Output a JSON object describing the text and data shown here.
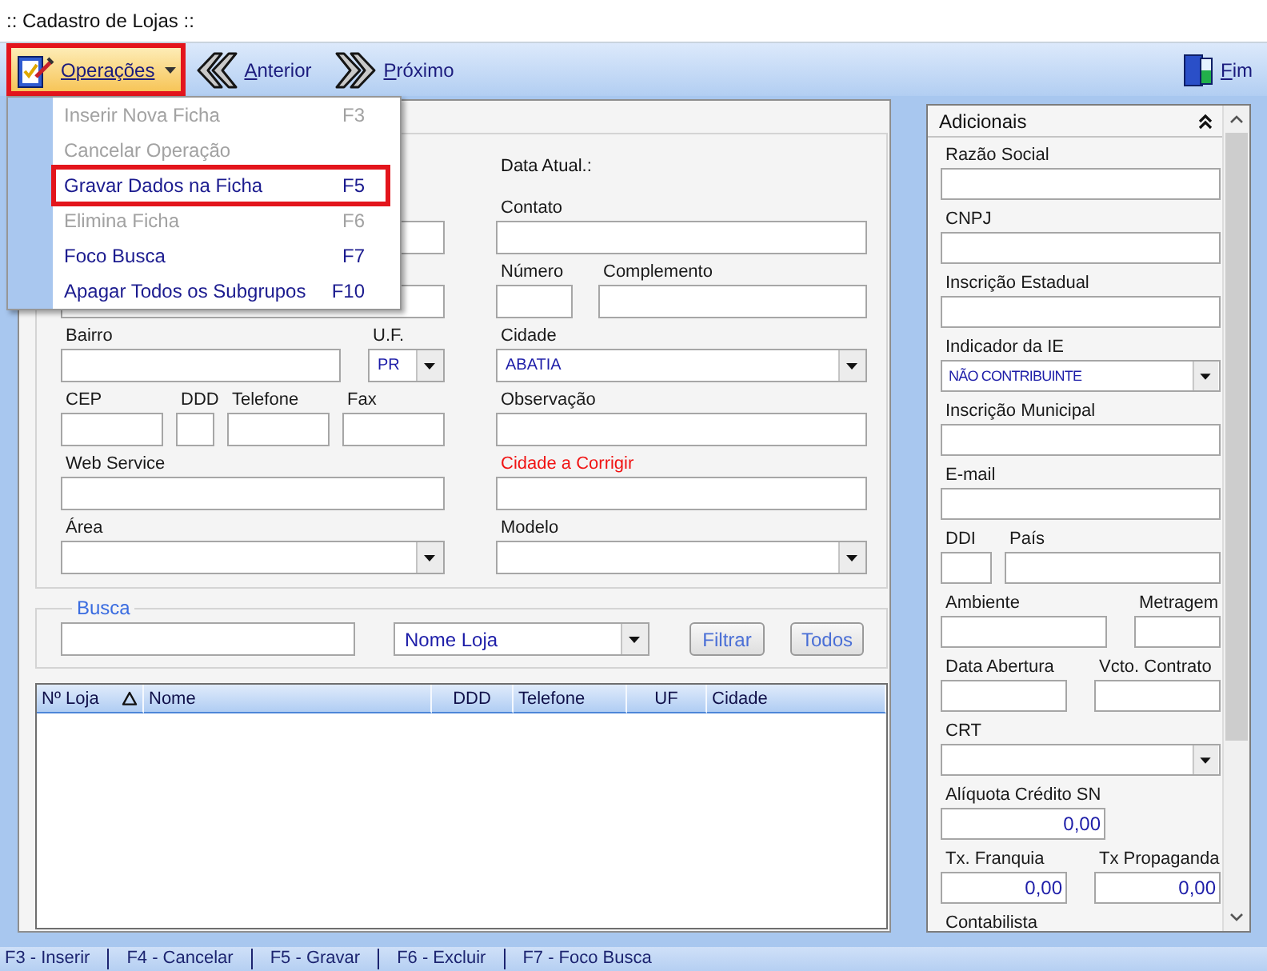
{
  "window": {
    "title": ":: Cadastro de Lojas ::"
  },
  "toolbar": [
    {
      "label": "Operações",
      "kind": "menu",
      "open": true,
      "highlighted": true
    },
    {
      "label": "Anterior",
      "kind": "previous",
      "open": false,
      "highlighted": false
    },
    {
      "label": "Próximo",
      "kind": "next",
      "open": false,
      "highlighted": false
    },
    {
      "label": "Fim",
      "kind": "exit",
      "open": false,
      "highlighted": false
    }
  ],
  "menu": {
    "items": [
      {
        "label": "Inserir Nova Ficha",
        "shortcut": "F3",
        "disabled": true,
        "highlighted": false
      },
      {
        "label": "Cancelar Operação",
        "disabled": true,
        "highlighted": false
      },
      {
        "label": "Gravar Dados na Ficha",
        "shortcut": "F5",
        "disabled": false,
        "highlighted": true
      },
      {
        "label": "Elimina Ficha",
        "shortcut": "F6",
        "disabled": true,
        "highlighted": false
      },
      {
        "label": "Foco Busca",
        "shortcut": "F7",
        "disabled": false,
        "highlighted": false
      },
      {
        "label": "Apagar Todos os Subgrupos",
        "shortcut": "F10",
        "disabled": false,
        "highlighted": false
      }
    ]
  },
  "form": {
    "date_label": "Data Atual.:",
    "covered_fields": [
      {
        "kind": "text"
      },
      {
        "kind": "text"
      }
    ],
    "left_fields": [
      {
        "label": "Bairro",
        "kind": "text",
        "alert": false
      },
      {
        "label": "U.F.",
        "kind": "combo",
        "value": "PR",
        "alert": false
      },
      {
        "label": "CEP",
        "kind": "text",
        "alert": false
      },
      {
        "label": "DDD",
        "kind": "text",
        "alert": false
      },
      {
        "label": "Telefone",
        "kind": "text",
        "alert": false
      },
      {
        "label": "Fax",
        "kind": "text",
        "alert": false
      },
      {
        "label": "Web Service",
        "kind": "text",
        "alert": false
      },
      {
        "label": "Área",
        "kind": "combo",
        "alert": false
      }
    ],
    "right_fields": [
      {
        "label": "Contato",
        "kind": "text",
        "alert": false
      },
      {
        "label": "Número",
        "kind": "text",
        "alert": false
      },
      {
        "label": "Complemento",
        "kind": "text",
        "alert": false
      },
      {
        "label": "Cidade",
        "kind": "combo",
        "value": "ABATIA",
        "alert": false
      },
      {
        "label": "Observação",
        "kind": "text",
        "alert": false
      },
      {
        "label": "Cidade a Corrigir",
        "kind": "text",
        "alert": true
      },
      {
        "label": "Modelo",
        "kind": "combo",
        "alert": false
      }
    ]
  },
  "search": {
    "label": "Busca",
    "sort_by": "Nome Loja",
    "buttons": [
      "Filtrar",
      "Todos"
    ]
  },
  "table": {
    "columns": [
      {
        "label": "Nº Loja",
        "sorted": true
      },
      {
        "label": "Nome",
        "sorted": false
      },
      {
        "label": "DDD",
        "sorted": false
      },
      {
        "label": "Telefone",
        "sorted": false
      },
      {
        "label": "UF",
        "sorted": false
      },
      {
        "label": "Cidade",
        "sorted": false
      }
    ]
  },
  "additional": {
    "title": "Adicionais",
    "expanded": true,
    "fields": [
      {
        "label": "Razão Social",
        "kind": "text"
      },
      {
        "label": "CNPJ",
        "kind": "text"
      },
      {
        "label": "Inscrição Estadual",
        "kind": "text"
      },
      {
        "label": "Indicador da IE",
        "kind": "combo",
        "value": "NÃO CONTRIBUINTE"
      },
      {
        "label": "Inscrição Municipal",
        "kind": "text"
      },
      {
        "label": "E-mail",
        "kind": "text"
      },
      {
        "label": "DDI",
        "kind": "text"
      },
      {
        "label": "País",
        "kind": "text"
      },
      {
        "label": "Ambiente",
        "kind": "text"
      },
      {
        "label": "Metragem",
        "kind": "text"
      },
      {
        "label": "Data Abertura",
        "kind": "text"
      },
      {
        "label": "Vcto. Contrato",
        "kind": "text"
      },
      {
        "label": "CRT",
        "kind": "combo"
      },
      {
        "label": "Alíquota Crédito SN",
        "kind": "number",
        "value": "0,00"
      },
      {
        "label": "Tx. Franquia",
        "kind": "number",
        "value": "0,00"
      },
      {
        "label": "Tx Propaganda",
        "kind": "number",
        "value": "0,00"
      },
      {
        "label": "Contabilista",
        "kind": "label"
      }
    ]
  },
  "status_bar": [
    "F3 - Inserir",
    "F4 - Cancelar",
    "F5 - Gravar",
    "F6 - Excluir",
    "F7 - Foco Busca"
  ]
}
